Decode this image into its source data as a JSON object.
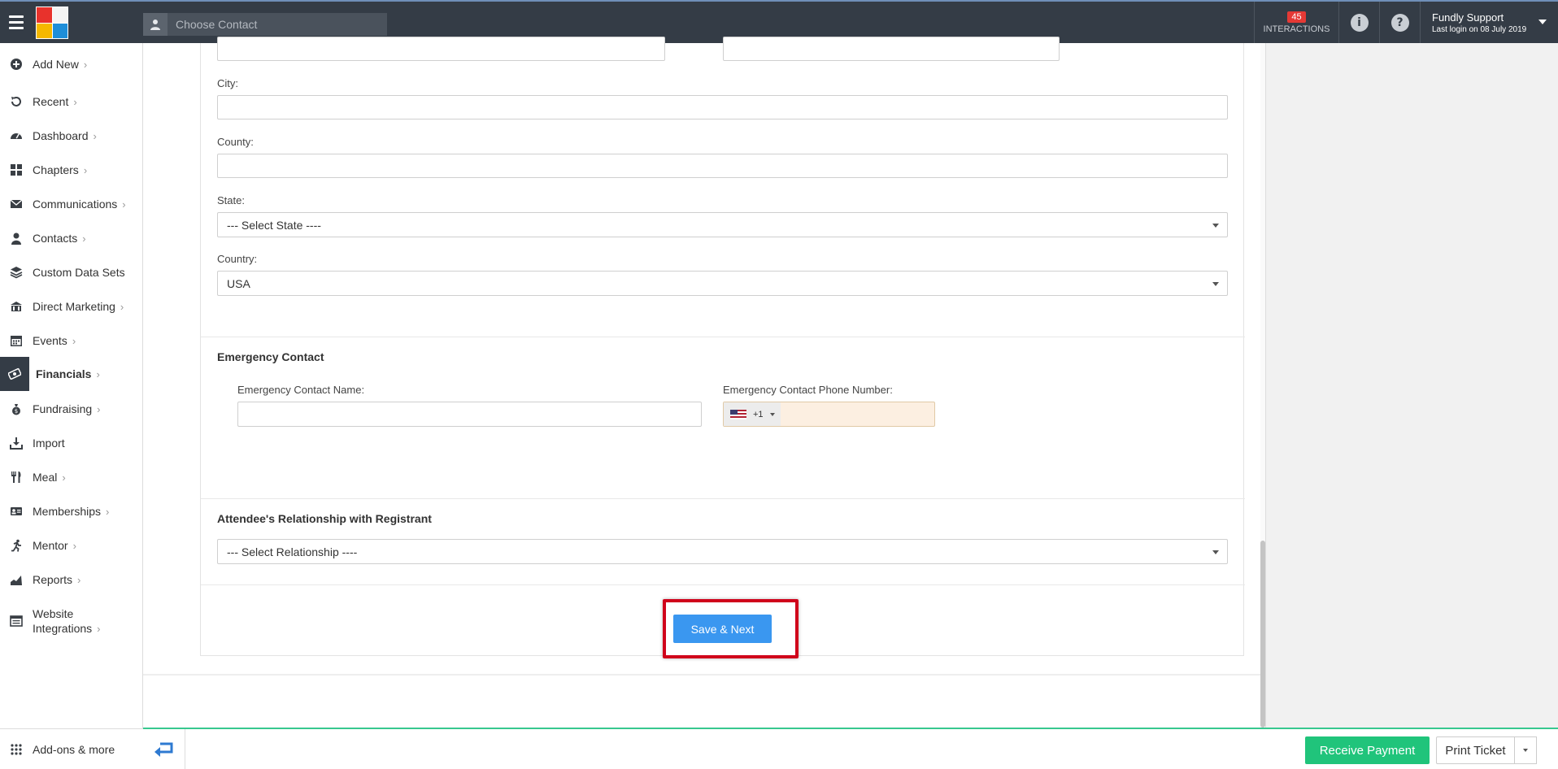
{
  "header": {
    "contact_placeholder": "Choose Contact",
    "interactions_count": "45",
    "interactions_label": "INTERACTIONS",
    "user_name": "Fundly Support",
    "last_login": "Last login on 08 July 2019"
  },
  "sidebar": {
    "items": [
      {
        "label": "Add New",
        "icon": "plus-circle-icon",
        "chevron": true
      },
      {
        "label": "Recent",
        "icon": "history-icon",
        "chevron": true
      },
      {
        "label": "Dashboard",
        "icon": "dashboard-icon",
        "chevron": true
      },
      {
        "label": "Chapters",
        "icon": "grid-icon",
        "chevron": true
      },
      {
        "label": "Communications",
        "icon": "envelope-icon",
        "chevron": true
      },
      {
        "label": "Contacts",
        "icon": "user-icon",
        "chevron": true
      },
      {
        "label": "Custom Data Sets",
        "icon": "layers-icon",
        "chevron": false
      },
      {
        "label": "Direct Marketing",
        "icon": "bank-icon",
        "chevron": true
      },
      {
        "label": "Events",
        "icon": "calendar-icon",
        "chevron": true
      },
      {
        "label": "Financials",
        "icon": "money-icon",
        "chevron": true
      },
      {
        "label": "Fundraising",
        "icon": "money-bag-icon",
        "chevron": true
      },
      {
        "label": "Import",
        "icon": "import-icon",
        "chevron": false
      },
      {
        "label": "Meal",
        "icon": "cutlery-icon",
        "chevron": true
      },
      {
        "label": "Memberships",
        "icon": "id-card-icon",
        "chevron": true
      },
      {
        "label": "Mentor",
        "icon": "running-icon",
        "chevron": true
      },
      {
        "label": "Reports",
        "icon": "chart-icon",
        "chevron": true
      },
      {
        "label_line1": "Website",
        "label_line2": "Integrations",
        "icon": "browser-icon",
        "chevron": true
      }
    ],
    "addons_label": "Add-ons & more"
  },
  "form": {
    "city_label": "City:",
    "county_label": "County:",
    "state_label": "State:",
    "state_value": "--- Select State ----",
    "country_label": "Country:",
    "country_value": "USA",
    "emergency_title": "Emergency Contact",
    "emergency_name_label": "Emergency Contact Name:",
    "emergency_phone_label": "Emergency Contact Phone Number:",
    "phone_code": "+1",
    "relationship_title": "Attendee's Relationship with Registrant",
    "relationship_value": "--- Select Relationship ----",
    "save_label": "Save & Next"
  },
  "footer": {
    "receive_payment": "Receive Payment",
    "print_ticket": "Print Ticket"
  },
  "colors": {
    "topbar": "#343c46",
    "primary_button": "#3a97f0",
    "success_button": "#20c47b",
    "highlight": "#d0021b"
  }
}
